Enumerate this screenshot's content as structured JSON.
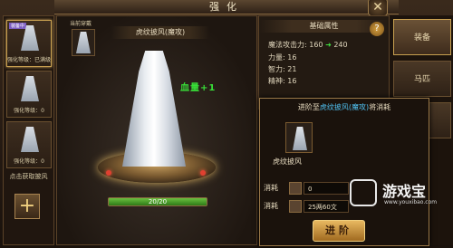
{
  "window": {
    "title": "强化",
    "close_icon": "close-icon"
  },
  "left_list": {
    "items": [
      {
        "label": "强化等级：已满级",
        "badge": "装备中",
        "selected": true
      },
      {
        "label": "强化等级：0",
        "selected": false
      },
      {
        "label": "强化等级：0",
        "selected": false
      }
    ],
    "get_more_label": "点击获取披风",
    "add_icon": "plus-icon"
  },
  "stage": {
    "current_equipped_label": "当前穿戴",
    "item_name": "虎纹披风(魔攻)",
    "bonus": "血量+1",
    "progress_text": "20/20",
    "progress": 1.0
  },
  "attributes": {
    "header": "基础属性",
    "help_icon": "question-icon",
    "rows": [
      {
        "name": "魔法攻击力:",
        "value": "160",
        "upgrade": "240"
      },
      {
        "name": "力量:",
        "value": "16"
      },
      {
        "name": "智力:",
        "value": "21"
      },
      {
        "name": "精神:",
        "value": "16"
      }
    ]
  },
  "tabs": [
    {
      "label": "装备",
      "active": true
    },
    {
      "label": "马匹",
      "active": false
    },
    {
      "label": "",
      "active": false
    }
  ],
  "advance": {
    "title_prefix": "进阶至",
    "title_target": "虎纹披风(魔攻)",
    "title_suffix": "将消耗",
    "material_name": "虎纹披风",
    "cost_label_1": "消耗",
    "cost_value_1": "0",
    "cost_label_2": "消耗",
    "cost_value_2": "25两60文",
    "button_label": "进阶"
  },
  "watermark": {
    "text": "游戏宝",
    "url": "www.youxibao.com"
  }
}
